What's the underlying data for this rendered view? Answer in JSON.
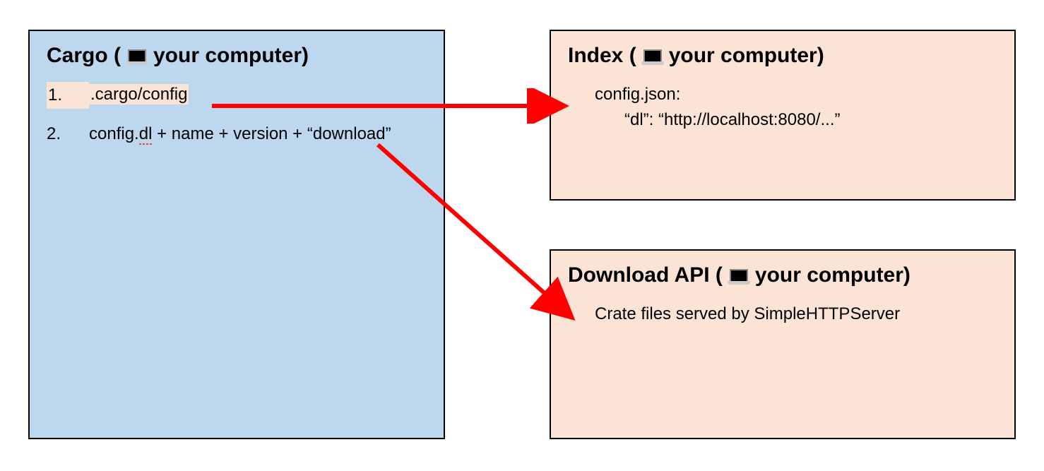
{
  "boxes": {
    "cargo": {
      "title_prefix": "Cargo (",
      "title_suffix": " your computer)",
      "items": [
        {
          "num": "1.",
          "text": ".cargo/config"
        },
        {
          "num": "2.",
          "text_pre": "config.",
          "text_underlined": "dl",
          "text_post": " + name + version + “download”"
        }
      ]
    },
    "index": {
      "title_prefix": "Index (",
      "title_suffix": " your computer)",
      "line1": "config.json:",
      "line2": "“dl”: “http://localhost:8080/...”"
    },
    "download": {
      "title_prefix": "Download API (",
      "title_suffix": " your computer)",
      "line1": "Crate files served by SimpleHTTPServer"
    }
  }
}
